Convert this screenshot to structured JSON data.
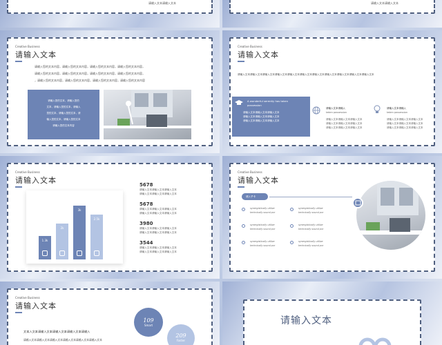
{
  "slide1": {
    "line": "请输入文本请输入文本"
  },
  "slide3": {
    "tag": "Creative Business",
    "title": "请输入文本",
    "paragraph": [
      "请输入您的文本内容，请输入您的文本内容，请输入您的文本内容，请输入您的文本内容，",
      "请输入您的文本内容，请输入您的文本内容，请输入您的文本内容，请输入您的文本内容，",
      "，请输入您的文本内容，请输入您的文本内容，请输入您的文本内容，请输入您的文本内容"
    ],
    "box_lines": [
      "请输入您的文本，请输入您的",
      "文本，请输入您的文本，请输入",
      "您的文本，请输入您的文本，请",
      "输入您的文本，请输入您的文本",
      "请输入您的文本内容"
    ]
  },
  "slide4": {
    "tag": "Creative Business",
    "title": "请输入文本",
    "banner": "请输入文本请输入文本请输入文本请输入文本请输入文本请输入文本请输入文本请输入文本请输入文本请输入文本请输入文本",
    "box_heading": "A wonderful serenity has taken possession",
    "box_lines": [
      "请输入文本请输入文本请输入文本",
      "请输入文本请输入文本请输入文本",
      "请输入文本请输入文本请输入文本"
    ],
    "col2": {
      "heading": "请输入文本请输入",
      "sub": "taken possession",
      "lines": [
        "请输入文本请输入文本请输入文本",
        "请输入文本请输入文本请输入文本",
        "请输入文本请输入文本请输入文本"
      ]
    },
    "col3": {
      "heading": "请输入文本请输入",
      "sub": "taken possession",
      "lines": [
        "请输入文本请输入文本请输入文本",
        "请输入文本请输入文本请输入文本",
        "请输入文本请输入文本请输入文本"
      ]
    }
  },
  "slide5": {
    "tag": "Creative Business",
    "title": "请输入文本",
    "stats": [
      {
        "value": "5678",
        "lines": [
          "请输入文本请输入文本请输入文本",
          "请输入文本请输入文本请输入文本"
        ]
      },
      {
        "value": "5678",
        "lines": [
          "请输入文本请输入文本请输入文本",
          "请输入文本请输入文本请输入文本"
        ]
      },
      {
        "value": "3980",
        "lines": [
          "请输入文本请输入文本请输入文本",
          "请输入文本请输入文本请输入文本"
        ]
      },
      {
        "value": "3544",
        "lines": [
          "请输入文本请输入文本请输入文本",
          "请输入文本请输入文本请输入文本"
        ]
      }
    ],
    "bars": [
      {
        "label": "1.3k",
        "value": 1.3,
        "icon": "twitter-icon",
        "color": "#6d84b5"
      },
      {
        "label": "2k",
        "value": 2,
        "icon": "facebook-icon",
        "color": "#b3c4e3"
      },
      {
        "label": "3k",
        "value": 3,
        "icon": "instagram-icon",
        "color": "#6d84b5"
      },
      {
        "label": "2.5k",
        "value": 2.5,
        "icon": "skype-icon",
        "color": "#b3c4e3"
      }
    ]
  },
  "slide6": {
    "tag": "Creative Business",
    "title": "请输入文本",
    "pill": "请入子卡",
    "items": [
      {
        "line1": "synergistically utilize",
        "line2": "technically sound por"
      },
      {
        "line1": "synergistically utilize",
        "line2": "technically sound por"
      },
      {
        "line1": "synergistically utilize",
        "line2": "technically sound por"
      },
      {
        "line1": "synergistically utilize",
        "line2": "technically sound por"
      },
      {
        "line1": "synergistically utilize",
        "line2": "technically sound por"
      },
      {
        "line1": "synergistically utilize",
        "line2": "technically sound por"
      }
    ]
  },
  "slide7": {
    "tag": "Creative Business",
    "title": "请输入文本",
    "line1": "文本入文本请输入文本请输入文本请输入文本请输入",
    "line2": "请输入文本请输入文本请输入文本请输入文本请输入文本请输入文本",
    "circle1": {
      "value": "109",
      "label": "Smart"
    },
    "circle2": {
      "value": "209",
      "label": "Faster"
    }
  },
  "slide8": {
    "title": "请输入文本"
  }
}
